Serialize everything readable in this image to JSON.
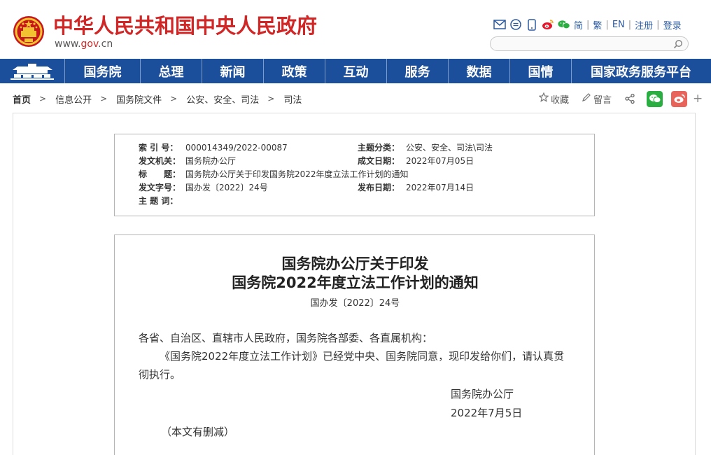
{
  "site": {
    "title": "中华人民共和国中央人民政府",
    "url_prefix": "www.",
    "url_brand": "gov",
    "url_suffix": ".cn",
    "brand_red": "#d12626",
    "nav_blue": "#1c4f9b"
  },
  "top_links": {
    "icons": [
      "email-icon",
      "message-icon",
      "mobile-icon",
      "weibo-icon",
      "wechat-icon"
    ],
    "simplified": "简",
    "traditional": "繁",
    "english": "EN",
    "register": "注册",
    "login": "登录",
    "separator": "|"
  },
  "search": {
    "placeholder": ""
  },
  "nav": {
    "items": [
      "国务院",
      "总理",
      "新闻",
      "政策",
      "互动",
      "服务",
      "数据",
      "国情",
      "国家政务服务平台"
    ]
  },
  "breadcrumb": {
    "items": [
      "首页",
      "信息公开",
      "国务院文件",
      "公安、安全、司法",
      "司法"
    ],
    "separator": ">"
  },
  "tools": {
    "favorite": "收藏",
    "comment": "留言",
    "share_icon": "share-icon",
    "plus": "+",
    "wechat_color": "#2aae42",
    "weibo_color": "#e8645a"
  },
  "meta": {
    "index_label": "索 引 号：",
    "index_value": "000014349/2022-00087",
    "category_label": "主题分类：",
    "category_value": "公安、安全、司法\\司法",
    "issuer_label": "发文机关：",
    "issuer_value": "国务院办公厅",
    "written_label": "成文日期：",
    "written_value": "2022年07月05日",
    "title_label": "标　　题：",
    "title_value": "国务院办公厅关于印发国务院2022年度立法工作计划的通知",
    "docno_label": "发文字号：",
    "docno_value": "国办发〔2022〕24号",
    "published_label": "发布日期：",
    "published_value": "2022年07月14日",
    "keywords_label": "主 题 词：",
    "keywords_value": ""
  },
  "doc": {
    "title_line1": "国务院办公厅关于印发",
    "title_line2": "国务院2022年度立法工作计划的通知",
    "number": "国办发〔2022〕24号",
    "salutation": "各省、自治区、直辖市人民政府，国务院各部委、各直属机构：",
    "body": "《国务院2022年度立法工作计划》已经党中央、国务院同意，现印发给你们，请认真贯彻执行。",
    "signature": "国务院办公厅",
    "date": "2022年7月5日",
    "note": "（本文有删减）"
  }
}
